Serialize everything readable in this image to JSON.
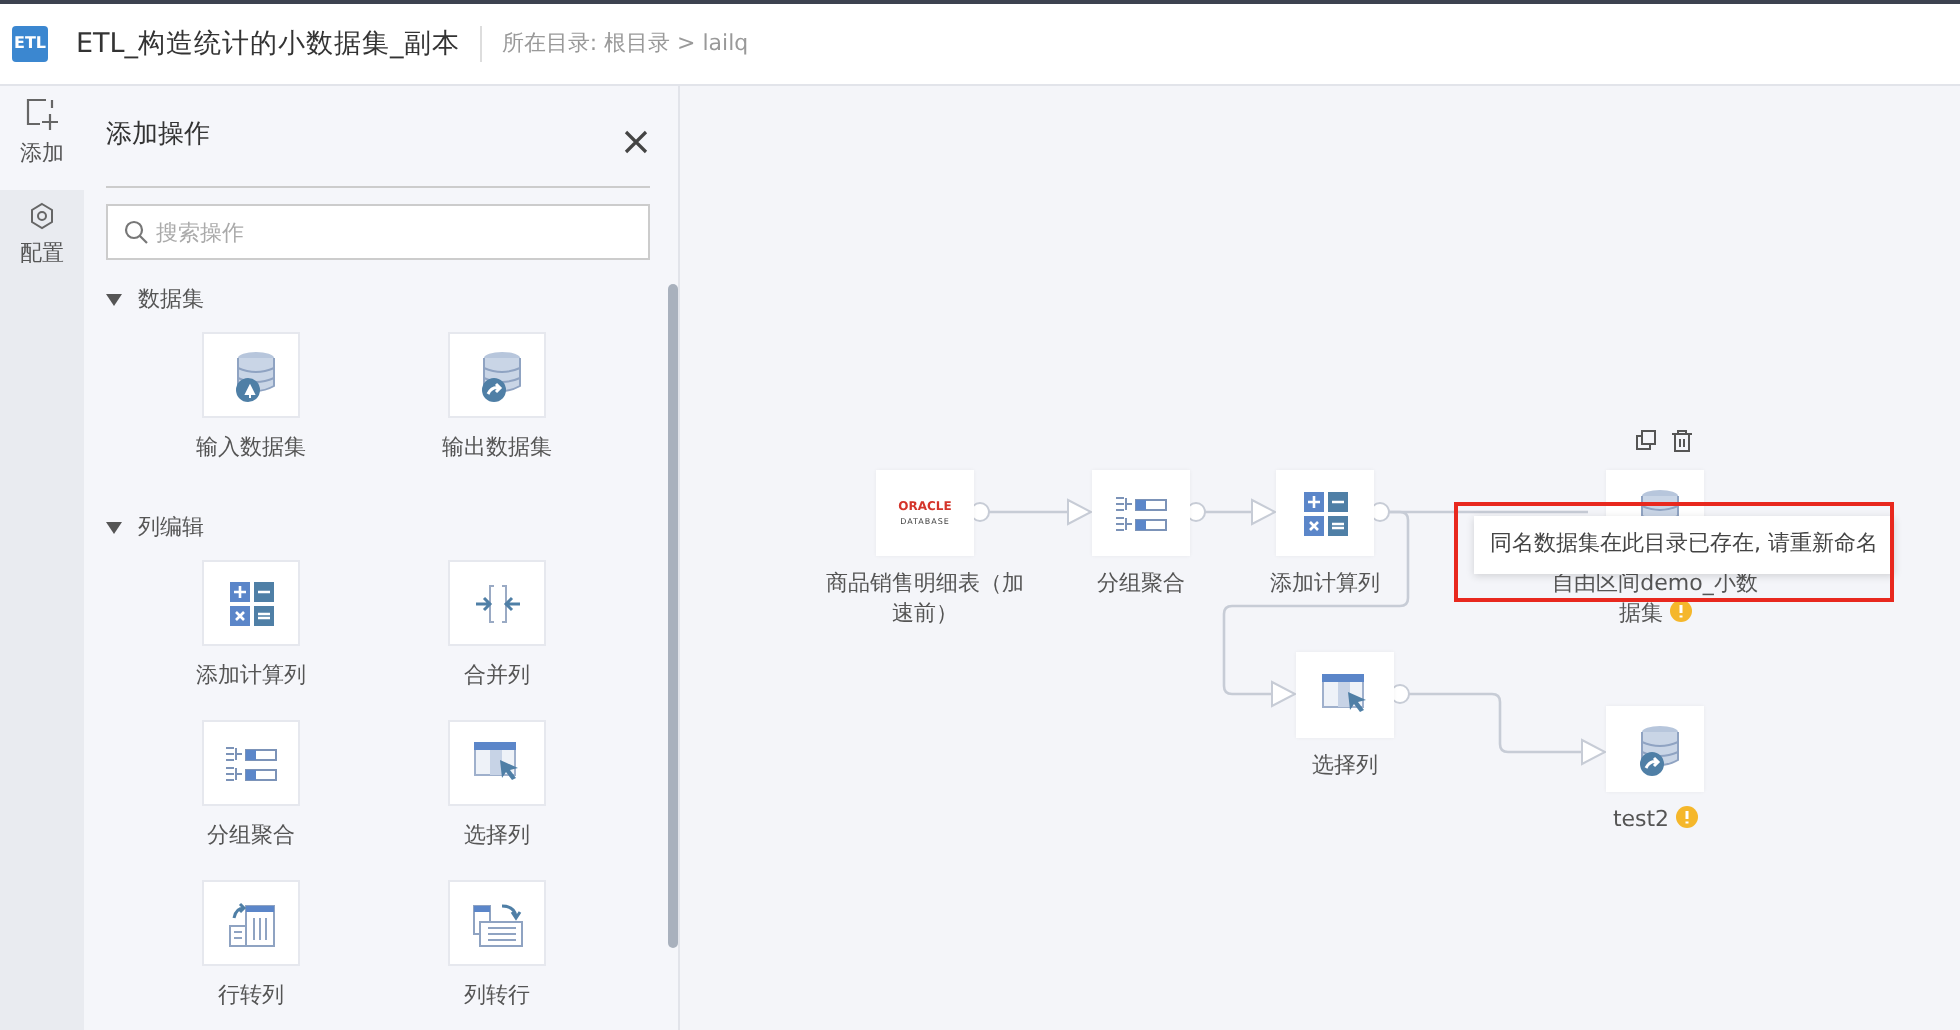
{
  "header": {
    "logo": "ETL",
    "title": "ETL_构造统计的小数据集_副本",
    "path": "所在目录: 根目录 > lailq"
  },
  "rail": [
    {
      "label": "添加",
      "selected": true
    },
    {
      "label": "配置",
      "selected": false
    }
  ],
  "panel": {
    "title": "添加操作",
    "search": {
      "placeholder": "搜索操作"
    },
    "sections": [
      {
        "title": "数据集",
        "expanded": true,
        "items": [
          {
            "label": "输入数据集",
            "kind": "input"
          },
          {
            "label": "输出数据集",
            "kind": "output"
          }
        ]
      },
      {
        "title": "列编辑",
        "expanded": true,
        "items": [
          {
            "label": "添加计算列",
            "kind": "calc"
          },
          {
            "label": "合并列",
            "kind": "merge"
          },
          {
            "label": "分组聚合",
            "kind": "group"
          },
          {
            "label": "选择列",
            "kind": "select"
          },
          {
            "label": "行转列",
            "kind": "rowtocol"
          },
          {
            "label": "列转行",
            "kind": "coltorow"
          }
        ]
      }
    ]
  },
  "canvas": {
    "nodes": [
      {
        "label": "商品销售明细表（加速前）",
        "kind": "source",
        "logo": [
          "ORACLE",
          "DATABASE"
        ],
        "warning": false,
        "selected": false
      },
      {
        "label": "分组聚合",
        "kind": "group",
        "warning": false,
        "selected": false
      },
      {
        "label": "添加计算列",
        "kind": "calc",
        "warning": false,
        "selected": false
      },
      {
        "label": "自由区间demo_小数据集",
        "kind": "output",
        "warning": true,
        "selected": true
      },
      {
        "label": "选择列",
        "kind": "select",
        "warning": false,
        "selected": false
      },
      {
        "label": "test2",
        "kind": "output",
        "warning": true,
        "selected": false
      }
    ],
    "tooltip": "同名数据集在此目录已存在, 请重新命名"
  }
}
